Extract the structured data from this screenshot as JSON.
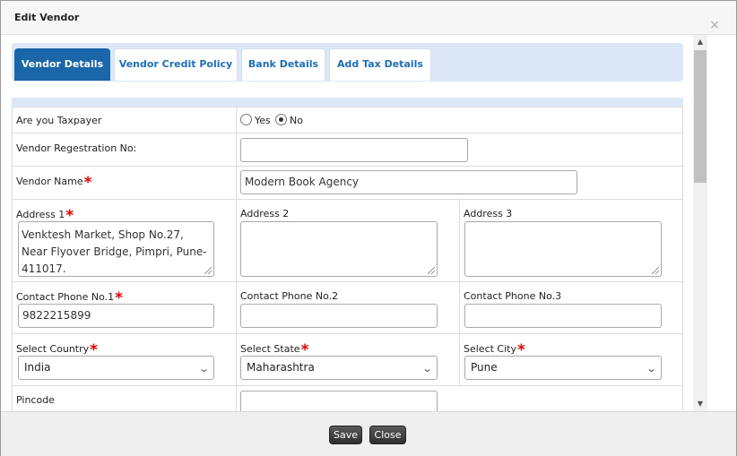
{
  "dialog": {
    "title": "Edit Vendor",
    "close_glyph": "×"
  },
  "tabs": [
    {
      "label": "Vendor Details",
      "active": true
    },
    {
      "label": "Vendor Credit Policy",
      "active": false
    },
    {
      "label": "Bank Details",
      "active": false
    },
    {
      "label": "Add Tax Details",
      "active": false
    }
  ],
  "form": {
    "taxpayer": {
      "label": "Are you Taxpayer",
      "options": [
        "Yes",
        "No"
      ],
      "selected": "No"
    },
    "reg_no": {
      "label": "Vendor Regestration No:",
      "value": ""
    },
    "vendor_name": {
      "label": "Vendor Name",
      "value": "Modern Book Agency"
    },
    "address1": {
      "label": "Address 1",
      "value": "Venktesh Market, Shop No.27, Near Flyover Bridge, Pimpri, Pune-411017."
    },
    "address2": {
      "label": "Address 2",
      "value": ""
    },
    "address3": {
      "label": "Address 3",
      "value": ""
    },
    "phone1": {
      "label": "Contact Phone No.1",
      "value": "9822215899"
    },
    "phone2": {
      "label": "Contact Phone No.2",
      "value": ""
    },
    "phone3": {
      "label": "Contact Phone No.3",
      "value": ""
    },
    "country": {
      "label": "Select Country",
      "value": "India"
    },
    "state": {
      "label": "Select State",
      "value": "Maharashtra"
    },
    "city": {
      "label": "Select City",
      "value": "Pune"
    },
    "pincode": {
      "label": "Pincode",
      "value": ""
    },
    "required_mark": "*"
  },
  "footer": {
    "save_label": "Save",
    "close_label": "Close"
  },
  "icons": {
    "chevron": "chevron-down-icon",
    "scroll_up": "▲",
    "scroll_down": "▼"
  },
  "colors": {
    "active_tab": "#1a66a8",
    "tab_text": "#1d6fb5",
    "required": "#e00000"
  }
}
